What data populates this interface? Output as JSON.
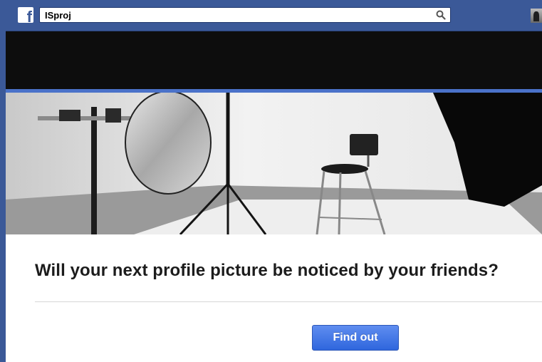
{
  "header": {
    "logo": "f",
    "search": {
      "value": "ISproj",
      "icon": "search-icon"
    },
    "avatar": "profile-avatar"
  },
  "content": {
    "headline": "Will your next profile picture be noticed by your friends?",
    "button_label": "Find out"
  },
  "colors": {
    "brand_blue": "#3b5998",
    "accent_line": "#4a72c9",
    "button_blue": "#3b6fe0",
    "dark_band": "#0d0d0d"
  }
}
